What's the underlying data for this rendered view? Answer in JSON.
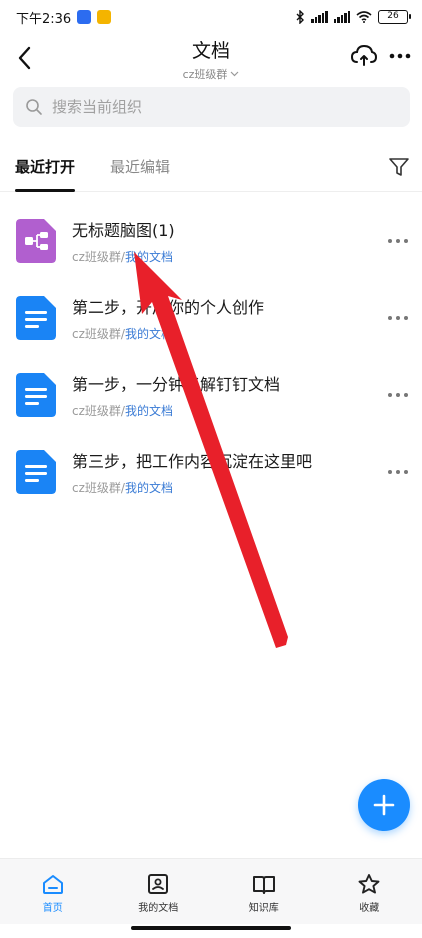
{
  "status_bar": {
    "time": "下午2:36",
    "battery": "26"
  },
  "header": {
    "title": "文档",
    "subtitle": "cz班级群"
  },
  "search": {
    "placeholder": "搜索当前组织"
  },
  "tabs": [
    {
      "label": "最近打开",
      "active": true
    },
    {
      "label": "最近编辑",
      "active": false
    }
  ],
  "documents": [
    {
      "title": "无标题脑图(1)",
      "group": "cz班级群",
      "folder": "我的文档",
      "icon": "mindmap-icon",
      "color": "#b15fcf"
    },
    {
      "title": "第二步，开启你的个人创作",
      "group": "cz班级群",
      "folder": "我的文档",
      "icon": "doc-icon",
      "color": "#1a84f5"
    },
    {
      "title": "第一步，一分钟了解钉钉文档",
      "group": "cz班级群",
      "folder": "我的文档",
      "icon": "doc-icon",
      "color": "#1a84f5"
    },
    {
      "title": "第三步，把工作内容沉淀在这里吧",
      "group": "cz班级群",
      "folder": "我的文档",
      "icon": "doc-icon",
      "color": "#1a84f5"
    }
  ],
  "separator": "/",
  "bottom_nav": [
    {
      "label": "首页",
      "icon": "home-icon",
      "active": true
    },
    {
      "label": "我的文档",
      "icon": "my-docs-icon",
      "active": false
    },
    {
      "label": "知识库",
      "icon": "book-icon",
      "active": false
    },
    {
      "label": "收藏",
      "icon": "star-icon",
      "active": false
    }
  ],
  "colors": {
    "accent": "#1a8cff",
    "link": "#3a7bd5",
    "mindmap": "#b15fcf",
    "doc": "#1a84f5",
    "arrow": "#e8202a"
  }
}
